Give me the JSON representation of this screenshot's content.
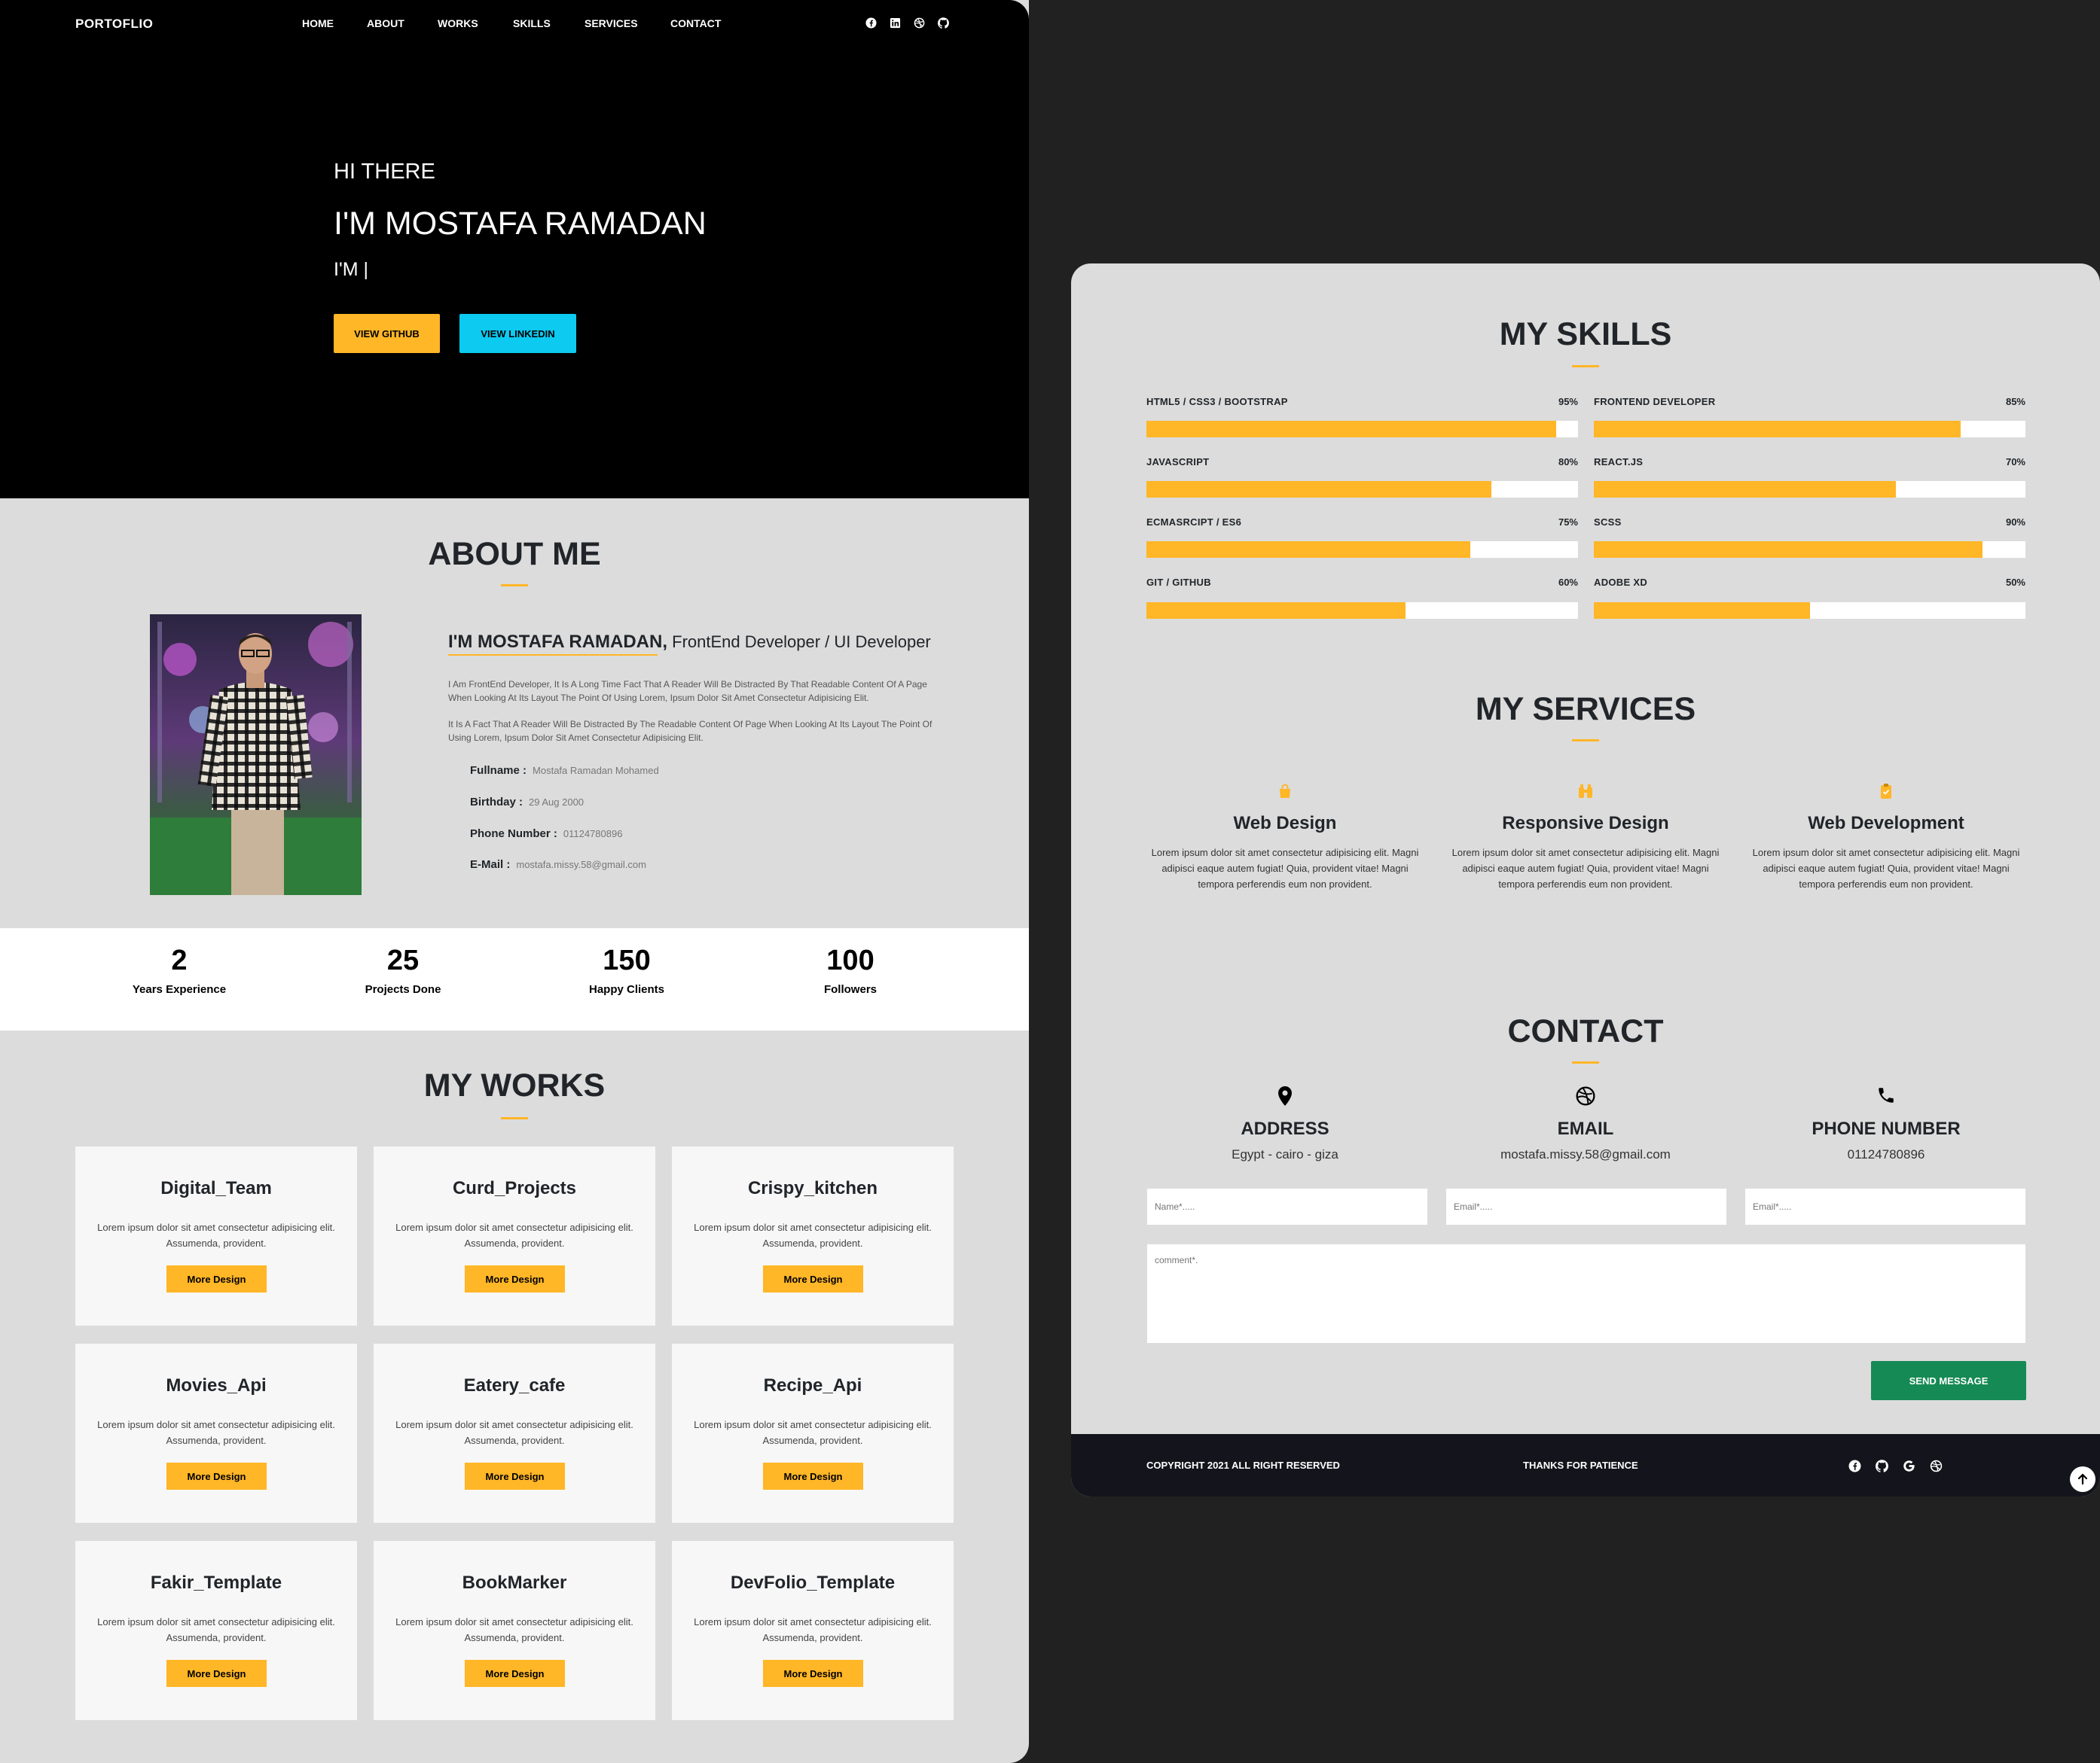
{
  "nav": {
    "logo": "PORTOFLIO",
    "links": [
      "HOME",
      "ABOUT",
      "WORKS",
      "SKILLS",
      "SERVICES",
      "CONTACT"
    ],
    "social_icons": [
      "facebook-icon",
      "linkedin-icon",
      "dribbble-icon",
      "github-icon"
    ]
  },
  "hero": {
    "greeting": "HI THERE",
    "name": "I'M MOSTAFA RAMADAN",
    "typed": "I'M |",
    "btn_github": "VIEW GITHUB",
    "btn_linkedin": "VIEW LINKEDIN"
  },
  "about": {
    "title": "ABOUT ME",
    "heading_name": "I'M MOSTAFA RAMADAN,",
    "heading_role": "FrontEnd Developer / UI Developer",
    "p1": "I Am FrontEnd Developer, It Is A Long Time Fact That A Reader Will Be Distracted By That Readable Content Of A Page When Looking At Its Layout The Point Of Using Lorem, Ipsum Dolor Sit Amet Consectetur Adipisicing Elit.",
    "p2": "It Is A Fact That A Reader Will Be Distracted By The Readable Content Of Page When Looking At Its Layout The Point Of Using Lorem, Ipsum Dolor Sit Amet Consectetur Adipisicing Elit.",
    "info": [
      {
        "label": "Fullname",
        "value": "Mostafa Ramadan Mohamed"
      },
      {
        "label": "Birthday",
        "value": "29 Aug 2000"
      },
      {
        "label": "Phone Number",
        "value": "01124780896"
      },
      {
        "label": "E-Mail",
        "value": "mostafa.missy.58@gmail.com"
      }
    ]
  },
  "stats": [
    {
      "num": "2",
      "label": "Years Experience"
    },
    {
      "num": "25",
      "label": "Projects Done"
    },
    {
      "num": "150",
      "label": "Happy Clients"
    },
    {
      "num": "100",
      "label": "Followers"
    }
  ],
  "works": {
    "title": "MY WORKS",
    "button": "More Design",
    "desc": "Lorem ipsum dolor sit amet consectetur adipisicing elit. Assumenda, provident.",
    "items": [
      "Digital_Team",
      "Curd_Projects",
      "Crispy_kitchen",
      "Movies_Api",
      "Eatery_cafe",
      "Recipe_Api",
      "Fakir_Template",
      "BookMarker",
      "DevFolio_Template"
    ]
  },
  "skills": {
    "title": "MY SKILLS",
    "items": [
      {
        "name": "HTML5 / CSS3 / BOOTSTRAP",
        "pct": "95%",
        "value": 95
      },
      {
        "name": "FRONTEND DEVELOPER",
        "pct": "85%",
        "value": 85
      },
      {
        "name": "JAVASCRIPT",
        "pct": "80%",
        "value": 80
      },
      {
        "name": "REACT.JS",
        "pct": "70%",
        "value": 70
      },
      {
        "name": "ECMASRCIPT / ES6",
        "pct": "75%",
        "value": 75
      },
      {
        "name": "SCSS",
        "pct": "90%",
        "value": 90
      },
      {
        "name": "GIT / GITHUB",
        "pct": "60%",
        "value": 60
      },
      {
        "name": "ADOBE XD",
        "pct": "50%",
        "value": 50
      }
    ]
  },
  "services": {
    "title": "MY SERVICES",
    "desc": "Lorem ipsum dolor sit amet consectetur adipisicing elit. Magni adipisci eaque autem fugiat! Quia, provident vitae! Magni tempora perferendis eum non provident.",
    "items": [
      {
        "title": "Web Design",
        "icon": "shopping-bag-icon"
      },
      {
        "title": "Responsive Design",
        "icon": "binoculars-icon"
      },
      {
        "title": "Web Development",
        "icon": "clipboard-icon"
      }
    ]
  },
  "contact": {
    "title": "CONTACT",
    "items": [
      {
        "title": "ADDRESS",
        "value": "Egypt - cairo - giza",
        "icon": "map-pin-icon"
      },
      {
        "title": "EMAIL",
        "value": "mostafa.missy.58@gmail.com",
        "icon": "dribbble-icon"
      },
      {
        "title": "PHONE NUMBER",
        "value": "01124780896",
        "icon": "phone-icon"
      }
    ],
    "placeholder_name": "Name*.....",
    "placeholder_email1": "Email*.....",
    "placeholder_email2": "Email*.....",
    "placeholder_comment": "comment*.",
    "send": "SEND MESSAGE"
  },
  "footer": {
    "copyright": "COPYRIGHT 2021 ALL RIGHT RESERVED",
    "thanks": "THANKS FOR PATIENCE",
    "icons": [
      "facebook-icon",
      "github-icon",
      "google-icon",
      "dribbble-icon"
    ]
  },
  "colors": {
    "accent": "#ffb627",
    "cyan": "#0dcaf0",
    "send": "#168a54",
    "footer": "#14151c"
  }
}
